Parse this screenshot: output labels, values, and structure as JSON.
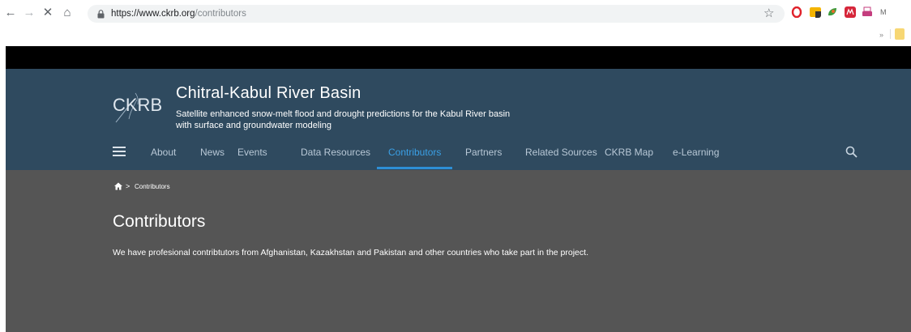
{
  "browser": {
    "url_host": "https://www.ckrb.org",
    "url_path": "/contributors",
    "profile_initial": "M",
    "more_extensions": "»"
  },
  "site": {
    "logo_text": "CKRB",
    "title": "Chitral-Kabul River Basin",
    "tagline": "Satellite enhanced snow-melt flood and drought predictions for the Kabul River basin with surface and groundwater modeling"
  },
  "nav": {
    "items": [
      "About",
      "News",
      "Events",
      "Data Resources",
      "Contributors",
      "Partners",
      "Related Sources",
      "CKRB Map",
      "e-Learning"
    ],
    "active_index": 4
  },
  "breadcrumb": {
    "separator": ">",
    "current": "Contributors"
  },
  "page": {
    "title": "Contributors",
    "description": "We have profesional contribtutors from Afghanistan, Kazakhstan and Pakistan and other countries who take part in the project."
  },
  "colors": {
    "header_bg": "#2f4a5f",
    "content_bg": "#555555",
    "nav_text": "#b8c8d6",
    "nav_active": "#3aa0e6"
  }
}
